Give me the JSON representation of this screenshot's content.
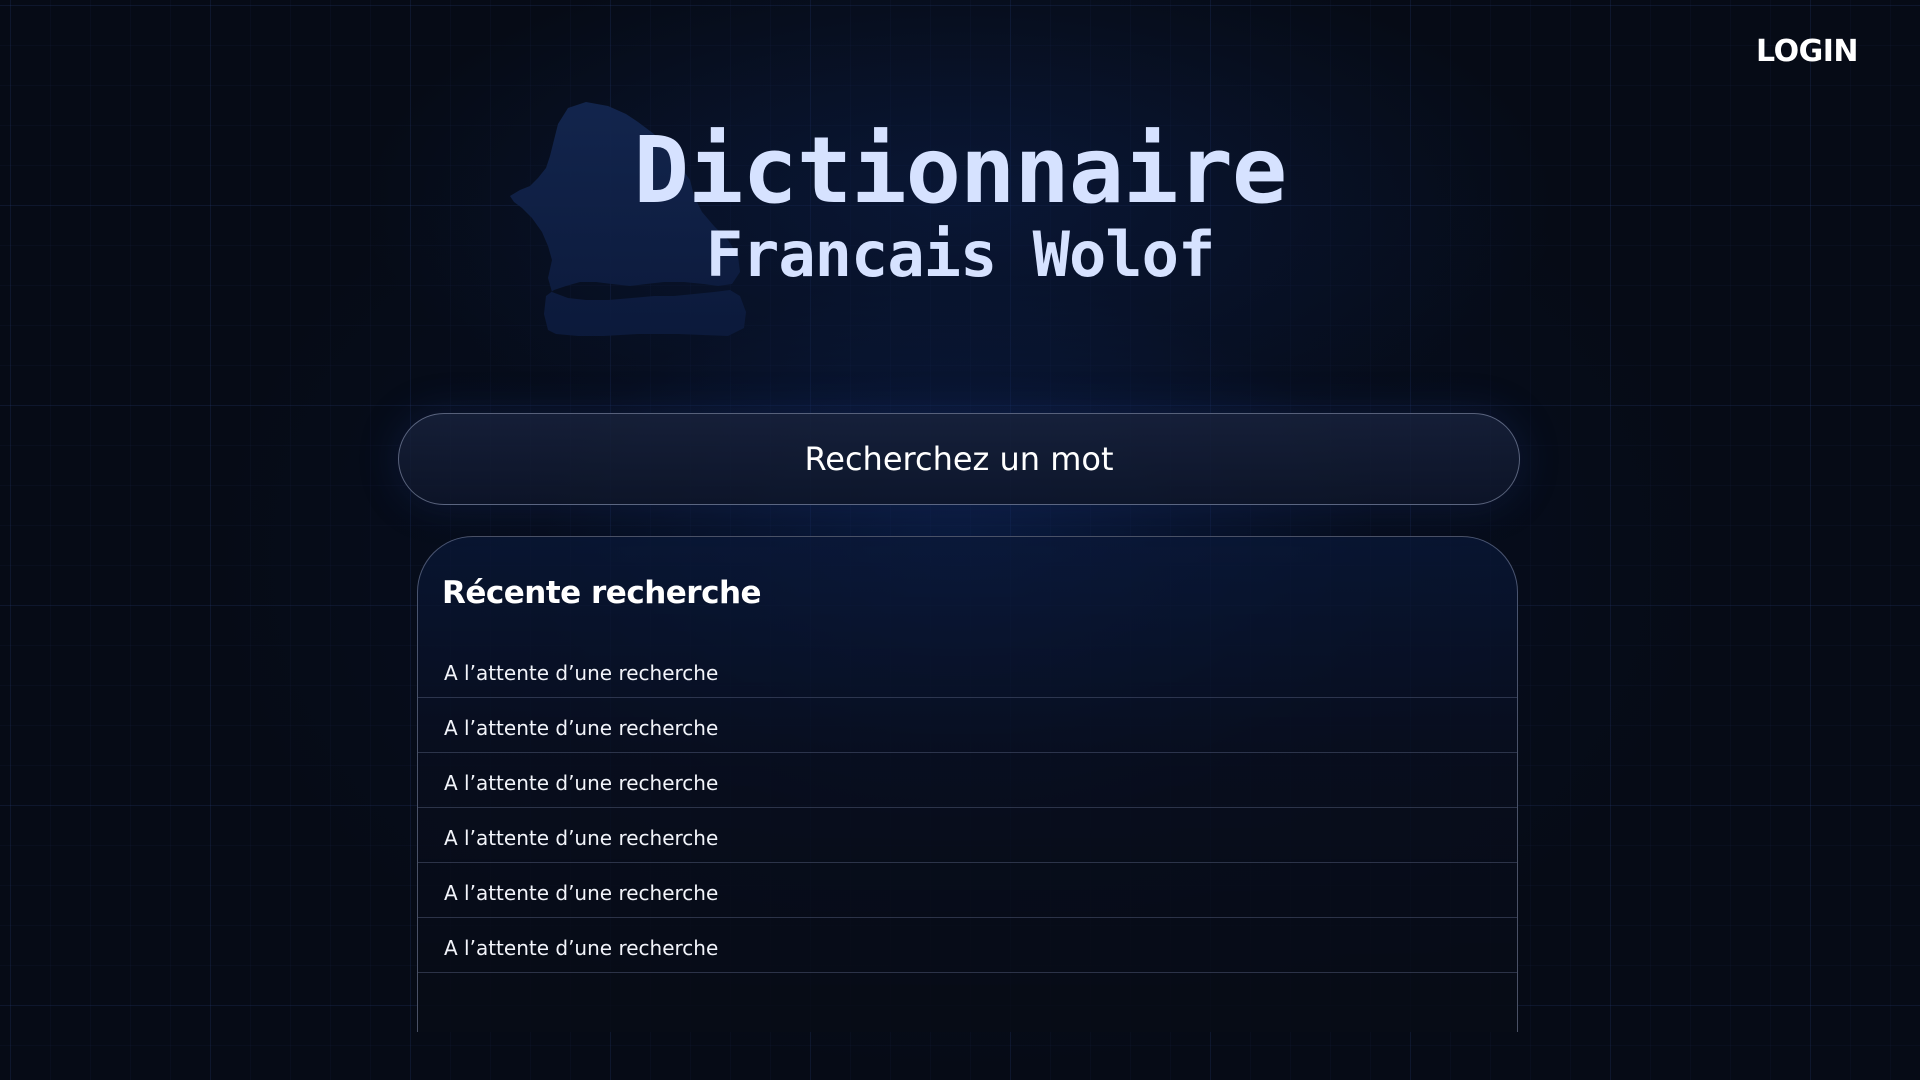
{
  "header": {
    "login_label": "LOGIN"
  },
  "hero": {
    "title": "Dictionnaire",
    "subtitle": "Francais Wolof",
    "background_icon": "senegal-map-silhouette"
  },
  "search": {
    "placeholder": "Recherchez un mot",
    "value": ""
  },
  "recent": {
    "title": "Récente recherche",
    "items": [
      "A l’attente d’une recherche",
      "A l’attente d’une recherche",
      "A l’attente d’une recherche",
      "A l’attente d’une recherche",
      "A l’attente d’une recherche",
      "A l’attente d’une recherche"
    ]
  },
  "colors": {
    "background": "#060b16",
    "title_text": "#d6e2ff",
    "text": "#ffffff",
    "map_silhouette": "#0f1e44"
  }
}
